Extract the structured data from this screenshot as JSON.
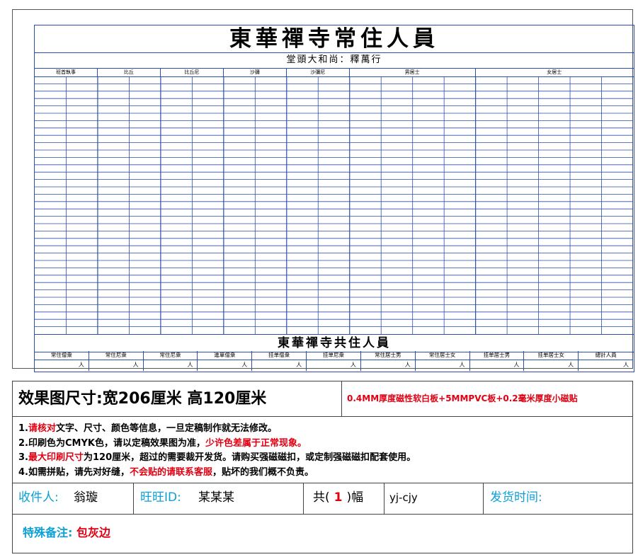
{
  "board": {
    "title": "東華禪寺常住人員",
    "abbot_line": "堂頭大和尚：釋萬行",
    "columns": [
      {
        "label": "班首執事",
        "subcols": 2
      },
      {
        "label": "比丘",
        "subcols": 2
      },
      {
        "label": "比丘尼",
        "subcols": 2
      },
      {
        "label": "沙彌",
        "subcols": 2
      },
      {
        "label": "沙彌尼",
        "subcols": 2
      },
      {
        "label": "男居士",
        "subcols": 4
      },
      {
        "label": "女居士",
        "subcols": 5
      }
    ],
    "row_count": 35,
    "total_title": "東華禪寺共住人員",
    "totals": [
      {
        "label": "常住僧衆",
        "unit": "人"
      },
      {
        "label": "常住尼衆",
        "unit": "人"
      },
      {
        "label": "常住尼衆",
        "unit": "人"
      },
      {
        "label": "進單僧衆",
        "unit": "人"
      },
      {
        "label": "挂单僧衆",
        "unit": "人"
      },
      {
        "label": "挂单尼衆",
        "unit": "人"
      },
      {
        "label": "常住居士男",
        "unit": "人"
      },
      {
        "label": "常住居士女",
        "unit": "人"
      },
      {
        "label": "挂单居士男",
        "unit": "人"
      },
      {
        "label": "挂单居士女",
        "unit": "人"
      },
      {
        "label": "總計人員",
        "unit": "人"
      }
    ]
  },
  "order": {
    "size_text": "效果图尺寸:宽206厘米  高120厘米",
    "material": "0.4MM厚度磁性软白板+5MMPVC板+0.2毫米厚度小磁贴",
    "notes": {
      "n1_a": "1.",
      "n1_red": "请核对",
      "n1_b": "文字、尺寸、颜色等信息，一旦定稿制作就无法修改。",
      "n2_a": "2.印刷色为CMYK色，请以定稿效果图为准，",
      "n2_red": "少许色差属于正常现象。",
      "n3_a": "3.",
      "n3_red": "最大印刷尺寸",
      "n3_b": "为120厘米，超过的需要裁开发货。请购买强磁磁扣，或定制强磁磁扣配套使用。",
      "n4_a": "4.如需拼贴，请先对好缝，",
      "n4_red": "不会贴的请联系客服",
      "n4_b": "，贴坏的我们概不负责。"
    },
    "recipient_label": "收件人:",
    "recipient_value": "翁璇",
    "wangwang_label": "旺旺ID:",
    "wangwang_value": "某某某",
    "count_prefix": "共(",
    "count_value": "1",
    "count_suffix": ")幅",
    "code": "yj-cjy",
    "ship_time_label": "发货时间:",
    "remark_label": "特殊备注:",
    "remark_value": "包灰边"
  },
  "colors": {
    "board_line": "#2b4ea8",
    "highlight_red": "#e00012",
    "label_cyan": "#0aa0d8"
  }
}
